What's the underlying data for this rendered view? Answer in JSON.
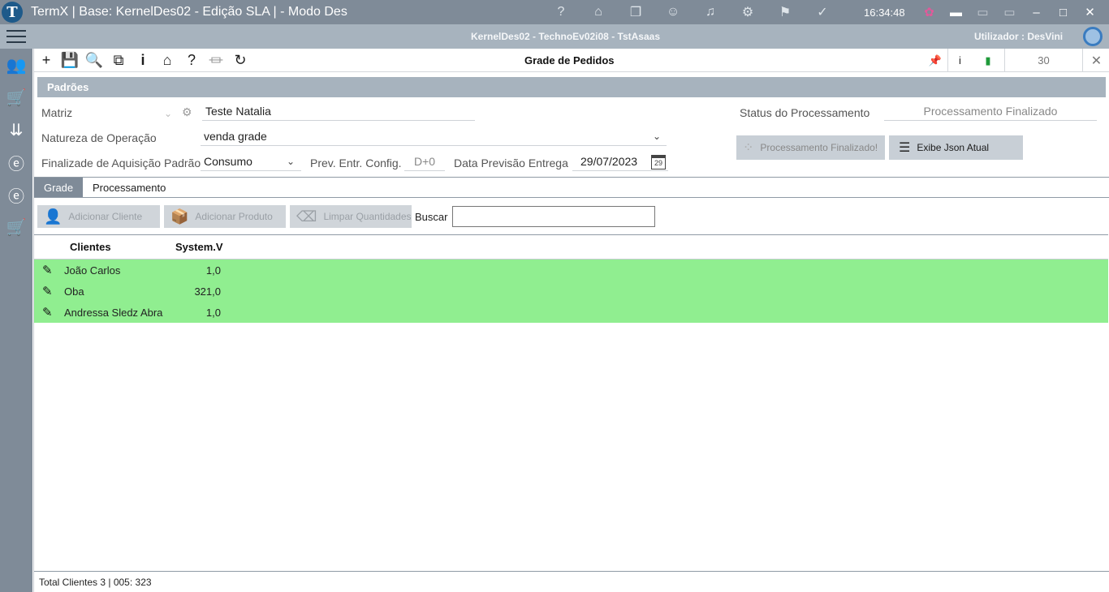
{
  "window": {
    "title": "TermX | Base: KernelDes02 - Edição SLA | - Modo Des",
    "clock": "16:34:48",
    "title_icons": [
      "question-icon",
      "bank-icon",
      "windows-icon",
      "user-icon",
      "bell-icon",
      "gear-icon",
      "flag-icon",
      "check-icon"
    ],
    "title_icon_glyphs": [
      "?",
      "⌂",
      "❐",
      "☺",
      "♫",
      "⚙",
      "⚑",
      "✓"
    ]
  },
  "header": {
    "context": "KernelDes02 - TechnoEv02i08 - TstAsaas",
    "user": "Utilizador : DesVini"
  },
  "toolbar": {
    "title": "Grade de Pedidos",
    "page_count": "30",
    "info_label": "i",
    "buttons": [
      "add-icon",
      "save-icon",
      "search-icon",
      "copy-icon",
      "info-icon",
      "report-icon",
      "help-icon",
      "bank-icon",
      "refresh-icon"
    ]
  },
  "section": {
    "title": "Padrões"
  },
  "form": {
    "matriz_label": "Matriz",
    "matriz_value": "Teste Natalia",
    "natureza_label": "Natureza de Operação",
    "natureza_value": "venda grade",
    "finalidade_label": "Finalizade de Aquisição Padrão",
    "finalidade_value": "Consumo",
    "prev_label": "Prev. Entr. Config.",
    "prev_value": "D+0",
    "data_prev_label": "Data Previsão Entrega",
    "data_prev_value": "29/07/2023",
    "calendar_day": "29",
    "status_label": "Status do Processamento",
    "status_value": "Processamento Finalizado",
    "btn_processamento": "Processamento Finalizado!",
    "btn_json": "Exibe Json Atual"
  },
  "tabs": [
    "Grade",
    "Processamento"
  ],
  "actions": {
    "add_client": "Adicionar Cliente",
    "add_product": "Adicionar Produto",
    "clear_qty": "Limpar Quantidades",
    "search_label": "Buscar",
    "search_value": ""
  },
  "grid": {
    "columns": [
      "Clientes",
      "System.V"
    ],
    "rows": [
      {
        "client": "João Carlos",
        "value": "1,0"
      },
      {
        "client": "Oba",
        "value": "321,0"
      },
      {
        "client": "Andressa Sledz Abra",
        "value": "1,0"
      }
    ],
    "row_color": "#90ee90"
  },
  "footer": {
    "text": "Total Clientes 3 | 005: 323"
  }
}
